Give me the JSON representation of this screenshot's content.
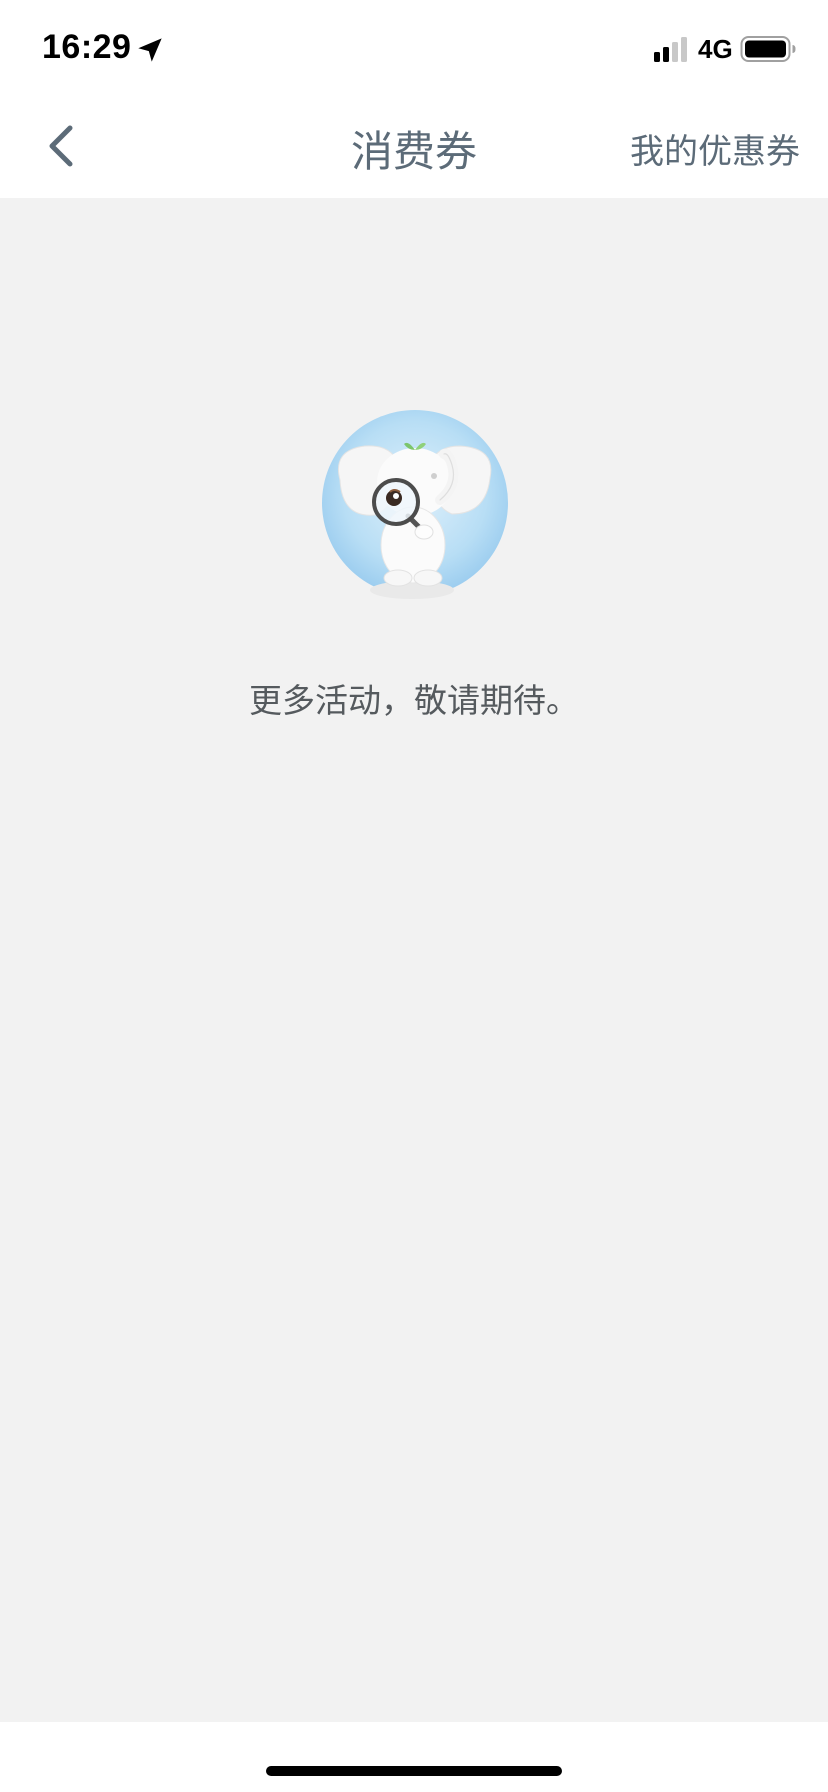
{
  "status_bar": {
    "time": "16:29",
    "network": "4G"
  },
  "nav": {
    "title": "消费券",
    "right_label": "我的优惠券"
  },
  "empty_state": {
    "message": "更多活动，敬请期待。"
  },
  "colors": {
    "accent_text": "#5c6b78",
    "background": "#f2f2f2",
    "illustration_circle": "#a9d4f2"
  }
}
